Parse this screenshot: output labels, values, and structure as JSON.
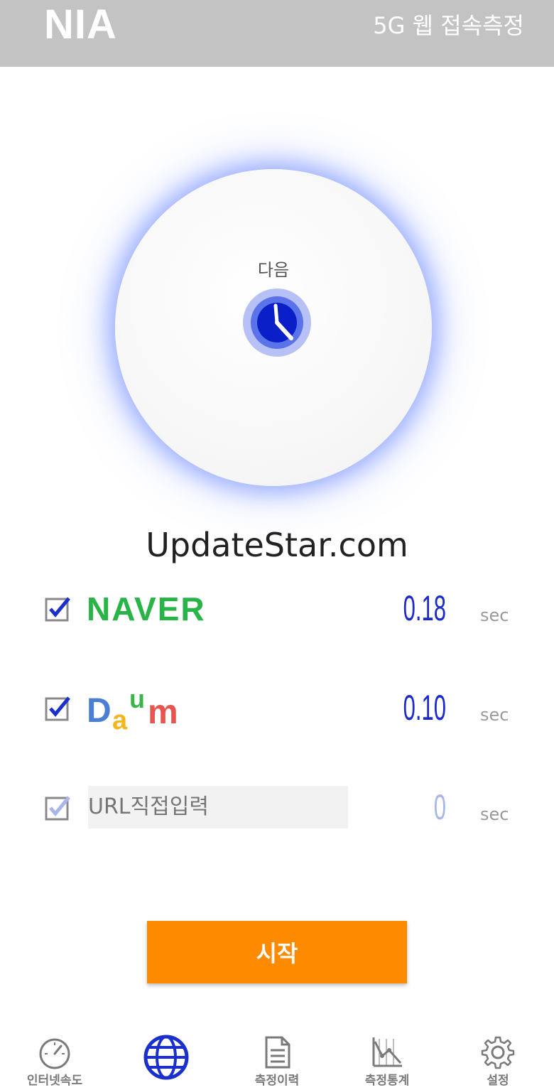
{
  "header": {
    "logo": "NIA",
    "title": "5G 웹 접속측정"
  },
  "dial": {
    "label": "다음",
    "icon": "clock-icon"
  },
  "watermark": "UpdateStar.com",
  "sites": [
    {
      "name": "NAVER",
      "checked": true,
      "value": "0.18",
      "unit": "sec"
    },
    {
      "name": "Daum",
      "checked": true,
      "value": "0.10",
      "unit": "sec"
    },
    {
      "name": "URL직접입력",
      "checked": true,
      "value": "0",
      "unit": "sec",
      "placeholder": "URL직접입력"
    }
  ],
  "daum_logo": {
    "letters": [
      "D",
      "a",
      "u",
      "m"
    ]
  },
  "start_button": "시작",
  "nav": {
    "items": [
      {
        "label": "인터넷속도",
        "icon": "speedometer-icon"
      },
      {
        "label": "",
        "icon": "globe-icon",
        "active": true
      },
      {
        "label": "측정이력",
        "icon": "document-icon"
      },
      {
        "label": "측정통계",
        "icon": "chart-icon"
      },
      {
        "label": "설정",
        "icon": "gear-icon"
      }
    ]
  },
  "colors": {
    "header": "#c3c3c3",
    "accent": "#fe8a00",
    "value": "#1a2acc",
    "naver": "#28b446",
    "active_nav": "#1a2fcc"
  }
}
